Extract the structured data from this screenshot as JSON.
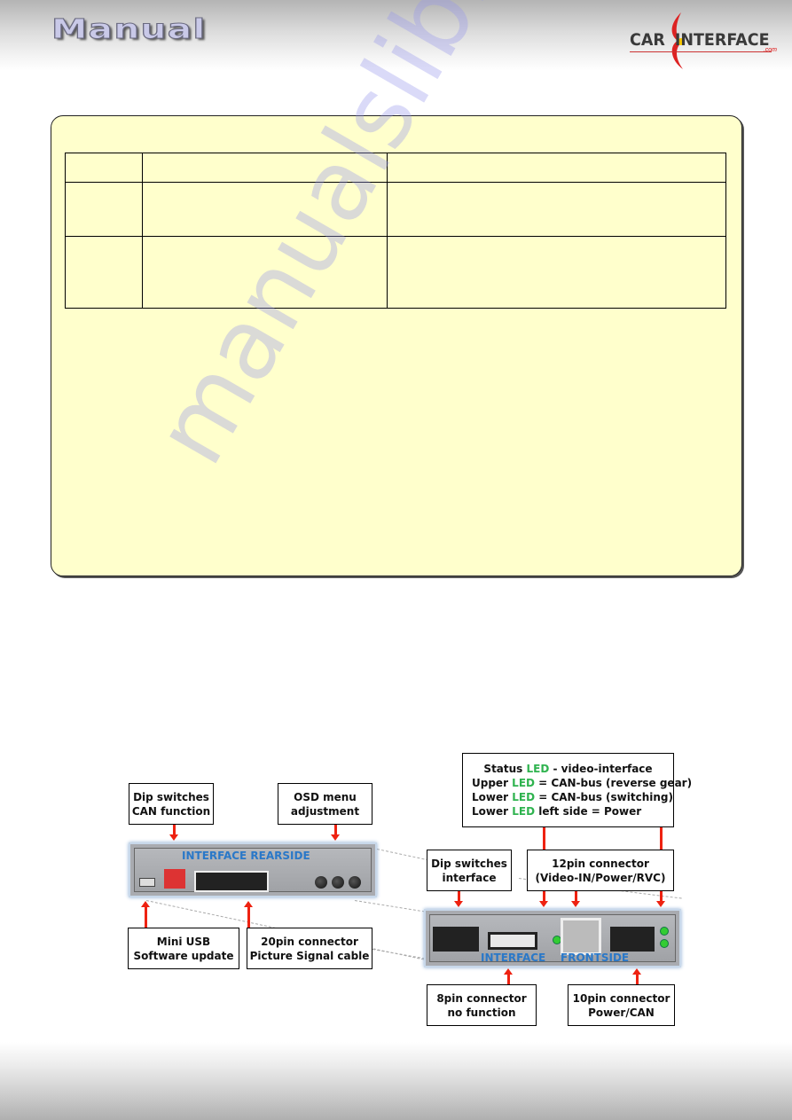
{
  "header": {
    "title": "Manual",
    "logo": {
      "left": "CAR",
      "right": "INTERFACE",
      "suffix": ".com"
    }
  },
  "note_box": {
    "table": {
      "header": [
        "",
        "",
        ""
      ],
      "rows": [
        [
          "",
          "",
          ""
        ],
        [
          "",
          "",
          ""
        ]
      ]
    }
  },
  "watermark": "manualslib.com",
  "diagram": {
    "rear_label": "INTERFACE  REARSIDE",
    "front_label_1": "INTERFACE",
    "front_label_2": "FRONTSIDE",
    "callouts": {
      "dip_can": [
        "Dip switches",
        "CAN function"
      ],
      "osd": [
        "OSD menu",
        "adjustment"
      ],
      "mini_usb": [
        "Mini USB",
        "Software update"
      ],
      "pin20": [
        "20pin connector",
        "Picture Signal cable"
      ],
      "dip_interface": [
        "Dip switches",
        "interface"
      ],
      "pin12": [
        "12pin connector",
        "(Video-IN/Power/RVC)"
      ],
      "pin8": [
        "8pin connector",
        "no function"
      ],
      "pin10": [
        "10pin connector",
        "Power/CAN"
      ]
    },
    "status": {
      "line1": {
        "pre": "Status ",
        "led": "LED",
        "post": " - video-interface"
      },
      "line2": {
        "pre": "Upper ",
        "led": "LED",
        "post": " = CAN-bus (reverse gear)"
      },
      "line3": {
        "pre": "Lower ",
        "led": "LED",
        "post": " = CAN-bus (switching)"
      },
      "line4": {
        "pre": "Lower ",
        "led": "LED",
        "post": " left side = Power"
      }
    },
    "colors": {
      "arrow": "#ee2211",
      "led_text": "#2fb34f",
      "device_label": "#2a78c8"
    }
  }
}
